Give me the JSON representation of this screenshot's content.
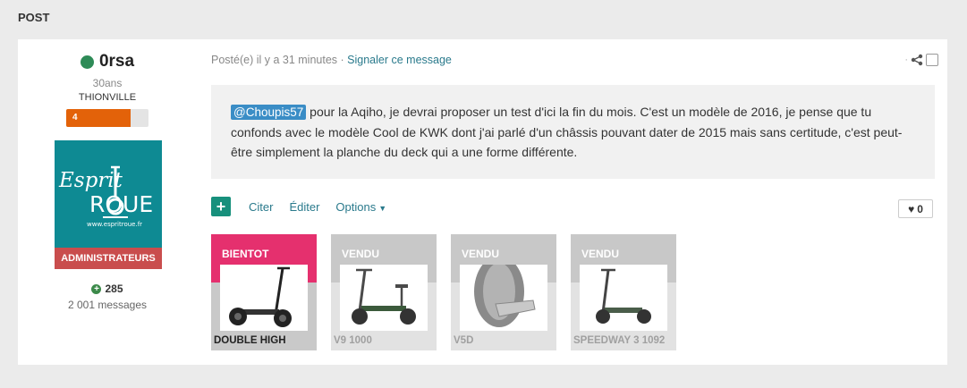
{
  "section": {
    "title": "POST"
  },
  "author": {
    "name": "0rsa",
    "age": "30ans",
    "city": "THIONVILLE",
    "rank_level": "4",
    "rank_progress": 0.78,
    "group": "ADMINISTRATEURS",
    "reputation": "285",
    "messages": "2 001 messages",
    "avatar_text_top": "Esprit",
    "avatar_text_bottom": "ROUE",
    "avatar_url_text": "www.espritroue.fr"
  },
  "post": {
    "meta": "Posté(e) il y a 31 minutes · ",
    "report_link": "Signaler ce message",
    "mention": "@Choupis57",
    "body": " pour la Aqiho, je devrai proposer un test d'ici la fin du mois. C'est un modèle de 2016, je pense que tu confonds avec le modèle Cool de KWK dont j'ai parlé d'un châssis pouvant dater de 2015 mais sans certitude, c'est peut-être simplement la planche du deck qui a une forme différente.",
    "actions": {
      "add": "+",
      "quote": "Citer",
      "edit": "Éditer",
      "options": "Options"
    },
    "likes": "0"
  },
  "products": [
    {
      "status": "BIENTOT",
      "name": "DOUBLE HIGH",
      "state": "active"
    },
    {
      "status": "VENDU",
      "name": "V9 1000",
      "state": "sold"
    },
    {
      "status": "VENDU",
      "name": "V5D",
      "state": "sold"
    },
    {
      "status": "VENDU",
      "name": "SPEEDWAY 3 1092",
      "state": "sold"
    }
  ],
  "colors": {
    "accent": "#2a7a8c",
    "online": "#2e8b57",
    "rank": "#e36209",
    "badge": "#c94d4d",
    "active_card": "#e5306e"
  }
}
